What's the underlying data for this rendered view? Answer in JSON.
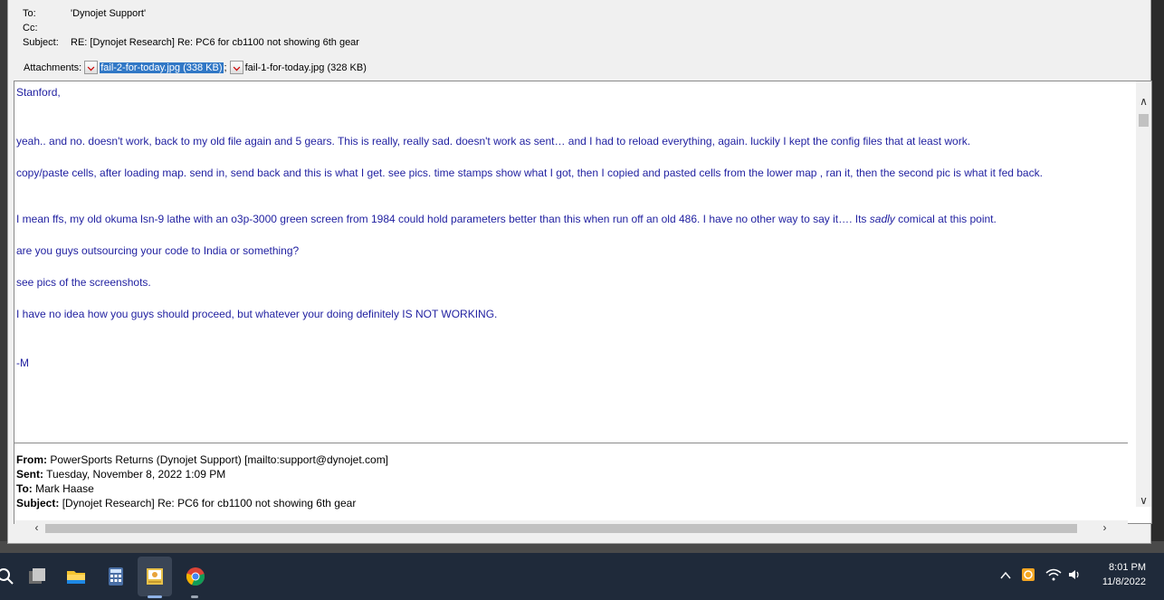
{
  "header": {
    "to_label": "To:",
    "to_value": "'Dynojet Support'",
    "cc_label": "Cc:",
    "cc_value": "",
    "subject_label": "Subject:",
    "subject_value": "RE: [Dynojet Research] Re: PC6 for cb1100 not showing 6th gear",
    "attachments_label": "Attachments:",
    "attachments": [
      {
        "name": "fail-2-for-today.jpg (338 KB)",
        "selected": true
      },
      {
        "name": "fail-1-for-today.jpg (328 KB)",
        "selected": false
      }
    ],
    "attach_separator": ";"
  },
  "message": {
    "greeting": "Stanford,",
    "p1": "yeah.. and no. doesn't work, back to my old file again and 5 gears. This is really, really sad. doesn't work as sent… and I had to reload everything, again. luckily I kept the config files that at least work.",
    "p2": "copy/paste cells, after loading map. send in, send back and this is what I get.  see pics. time stamps show what I got, then I copied and pasted cells from the lower map , ran it, then the second pic is what it fed back.",
    "p3_a": "I mean ffs, my old okuma lsn-9 lathe with an o3p-3000 green screen from 1984 could hold parameters better than this when run off an old 486. I have no other way to say it….  Its ",
    "p3_em": "sadly",
    "p3_b": " comical at this point.",
    "p4": "are you guys outsourcing your code to India or something?",
    "p5": "see pics of the screenshots.",
    "p6": "I have no idea how you guys should proceed, but whatever your doing definitely IS NOT WORKING.",
    "sign": "-M"
  },
  "forwarded": {
    "from_label": "From:",
    "from_value": "PowerSports Returns (Dynojet Support) [mailto:support@dynojet.com]",
    "sent_label": "Sent:",
    "sent_value": "Tuesday, November 8, 2022 1:09 PM",
    "to_label": "To:",
    "to_value": "Mark Haase",
    "subject_label": "Subject:",
    "subject_value": "[Dynojet Research] Re: PC6 for cb1100 not showing 6th gear"
  },
  "taskbar": {
    "icons": [
      "search-icon",
      "task-view-icon",
      "file-explorer-icon",
      "calculator-icon",
      "outlook-icon",
      "chrome-icon"
    ],
    "time": "8:01 PM",
    "date": "11/8/2022"
  },
  "colors": {
    "message_text": "#1f1fa0",
    "selection": "#3178c6",
    "taskbar": "#1f2a3a"
  }
}
